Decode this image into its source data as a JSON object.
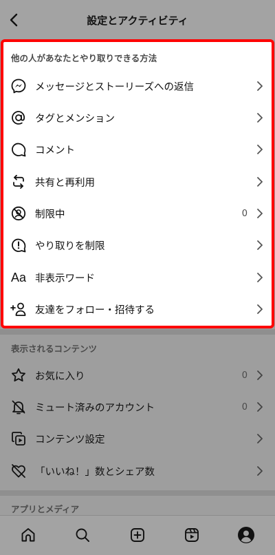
{
  "header": {
    "title": "設定とアクティビティ"
  },
  "section_interactions": {
    "title": "他の人があなたとやり取りできる方法",
    "items": [
      {
        "label": "メッセージとストーリーズへの返信",
        "icon": "messenger-icon"
      },
      {
        "label": "タグとメンション",
        "icon": "at-sign-icon"
      },
      {
        "label": "コメント",
        "icon": "comment-icon"
      },
      {
        "label": "共有と再利用",
        "icon": "repost-icon"
      },
      {
        "label": "制限中",
        "icon": "restricted-icon",
        "count": "0"
      },
      {
        "label": "やり取りを制限",
        "icon": "limit-interactions-icon"
      },
      {
        "label": "非表示ワード",
        "icon": "text-aa-icon",
        "glyph": "Aa"
      },
      {
        "label": "友達をフォロー・招待する",
        "icon": "add-person-icon"
      }
    ]
  },
  "section_content": {
    "title": "表示されるコンテンツ",
    "items": [
      {
        "label": "お気に入り",
        "icon": "star-icon",
        "count": "0"
      },
      {
        "label": "ミュート済みのアカウント",
        "icon": "bell-muted-icon",
        "count": "0"
      },
      {
        "label": "コンテンツ設定",
        "icon": "content-preferences-icon"
      },
      {
        "label": "「いいね！」数とシェア数",
        "icon": "heart-hidden-icon"
      }
    ]
  },
  "section_apps": {
    "title": "アプリとメディア"
  },
  "bottom_nav": [
    "home-icon",
    "search-icon",
    "new-post-icon",
    "reels-icon",
    "profile-icon"
  ],
  "colors": {
    "highlight_border": "#ff0000",
    "overlay_gray": "#9e9e9e"
  }
}
